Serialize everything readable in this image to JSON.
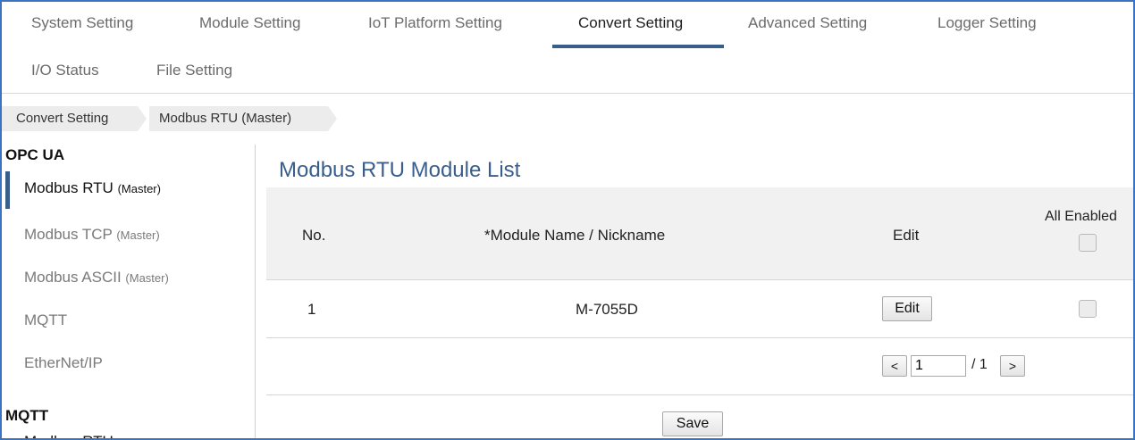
{
  "tabs": [
    {
      "label": "System Setting",
      "active": false
    },
    {
      "label": "Module Setting",
      "active": false
    },
    {
      "label": "IoT Platform Setting",
      "active": false
    },
    {
      "label": "Convert Setting",
      "active": true
    },
    {
      "label": "Advanced Setting",
      "active": false
    },
    {
      "label": "Logger Setting",
      "active": false
    },
    {
      "label": "I/O Status",
      "active": false
    },
    {
      "label": "File Setting",
      "active": false
    }
  ],
  "breadcrumb": [
    "Convert Setting",
    "Modbus RTU (Master)"
  ],
  "sidebar": {
    "section1_title": "OPC UA",
    "items": [
      {
        "label": "Modbus RTU",
        "suffix": "(Master)",
        "active": true
      },
      {
        "label": "Modbus TCP",
        "suffix": "(Master)",
        "active": false
      },
      {
        "label": "Modbus ASCII",
        "suffix": "(Master)",
        "active": false
      },
      {
        "label": "MQTT",
        "suffix": "",
        "active": false
      },
      {
        "label": "EtherNet/IP",
        "suffix": "",
        "active": false
      }
    ],
    "section2_title": "MQTT",
    "section2_partial_item": "Modbus RTU"
  },
  "main": {
    "title": "Modbus RTU Module List",
    "table": {
      "headers": {
        "no": "No.",
        "module_name": "*Module Name / Nickname",
        "edit": "Edit",
        "all_enabled": "All Enabled"
      },
      "all_enabled_checked": false,
      "rows": [
        {
          "no": "1",
          "module_name": "M-7055D",
          "edit_label": "Edit",
          "enabled": false
        }
      ]
    },
    "pagination": {
      "prev_label": "<",
      "current_page": "1",
      "total_text": "/ 1",
      "next_label": ">"
    },
    "save_label": "Save"
  },
  "colors": {
    "accent": "#3a5e8c",
    "frame_border": "#3b73c4",
    "header_bg": "#f1f1f1"
  }
}
